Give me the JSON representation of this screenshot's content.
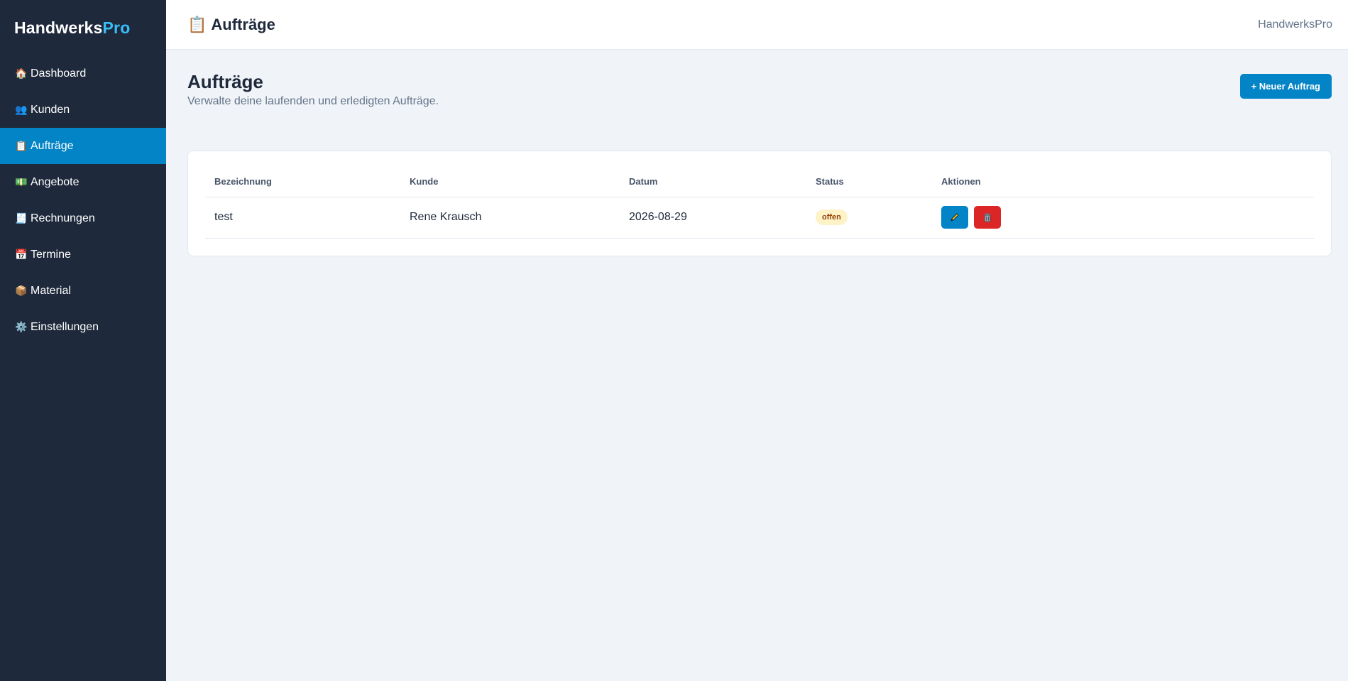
{
  "brand": {
    "name": "Handwerks",
    "accent": "Pro",
    "accent_color": "#38bdf8"
  },
  "sidebar": {
    "items": [
      {
        "label": "Dashboard",
        "icon": "house-icon",
        "glyph": "🏠",
        "active": false
      },
      {
        "label": "Kunden",
        "icon": "people-icon",
        "glyph": "👥",
        "active": false
      },
      {
        "label": "Aufträge",
        "icon": "clipboard-icon",
        "glyph": "📋",
        "active": true
      },
      {
        "label": "Angebote",
        "icon": "money-icon",
        "glyph": "💵",
        "active": false
      },
      {
        "label": "Rechnungen",
        "icon": "receipt-icon",
        "glyph": "🧾",
        "active": false
      },
      {
        "label": "Termine",
        "icon": "calendar-icon",
        "glyph": "📅",
        "active": false
      },
      {
        "label": "Material",
        "icon": "package-icon",
        "glyph": "📦",
        "active": false
      },
      {
        "label": "Einstellungen",
        "icon": "gear-icon",
        "glyph": "⚙️",
        "active": false
      }
    ]
  },
  "topbar": {
    "icon": "📋",
    "title": "Aufträge",
    "brand": "HandwerksPro"
  },
  "page": {
    "title": "Aufträge",
    "subtitle": "Verwalte deine laufenden und erledigten Aufträge.",
    "new_button": "+ Neuer Auftrag"
  },
  "table": {
    "columns": [
      "Bezeichnung",
      "Kunde",
      "Datum",
      "Status",
      "Aktionen"
    ],
    "rows": [
      {
        "bezeichnung": "test",
        "kunde": "Rene Krausch",
        "datum": "2026-08-29",
        "status": "offen"
      }
    ]
  },
  "colors": {
    "sidebar_bg": "#1e293b",
    "primary": "#0284c7",
    "danger": "#dc2626",
    "badge_bg": "#fef3c7",
    "badge_text": "#92400e"
  }
}
